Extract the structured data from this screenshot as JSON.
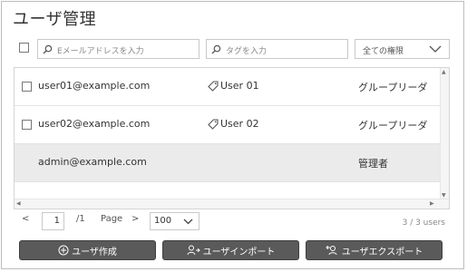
{
  "page": {
    "title": "ユーザ管理"
  },
  "filters": {
    "email_placeholder": "Eメールアドレスを入力",
    "tag_placeholder": "タグを入力",
    "role_selected": "全ての権限"
  },
  "users": [
    {
      "email": "user01@example.com",
      "tag": "User 01",
      "role": "グループリーダ",
      "has_checkbox": true,
      "selected": false
    },
    {
      "email": "user02@example.com",
      "tag": "User 02",
      "role": "グループリーダ",
      "has_checkbox": true,
      "selected": false
    },
    {
      "email": "admin@example.com",
      "tag": "",
      "role": "管理者",
      "has_checkbox": false,
      "selected": true
    }
  ],
  "pagination": {
    "prev": "<",
    "current_page": "1",
    "total_pages": "/1",
    "page_label": "Page",
    "next": ">",
    "per_page": "100",
    "count": "3 / 3 users"
  },
  "actions": {
    "create_user": "ユーザ作成",
    "import_users": "ユーザインポート",
    "export_users": "ユーザエクスポート"
  },
  "icons": {
    "search": "search-icon",
    "tag": "tag-icon",
    "dropdown": "chevron-down-icon",
    "add": "plus-circle-icon",
    "import": "user-import-icon",
    "export": "user-export-icon"
  },
  "colors": {
    "button_bg": "#5a5a5a",
    "selected_row_bg": "#ebebeb"
  }
}
